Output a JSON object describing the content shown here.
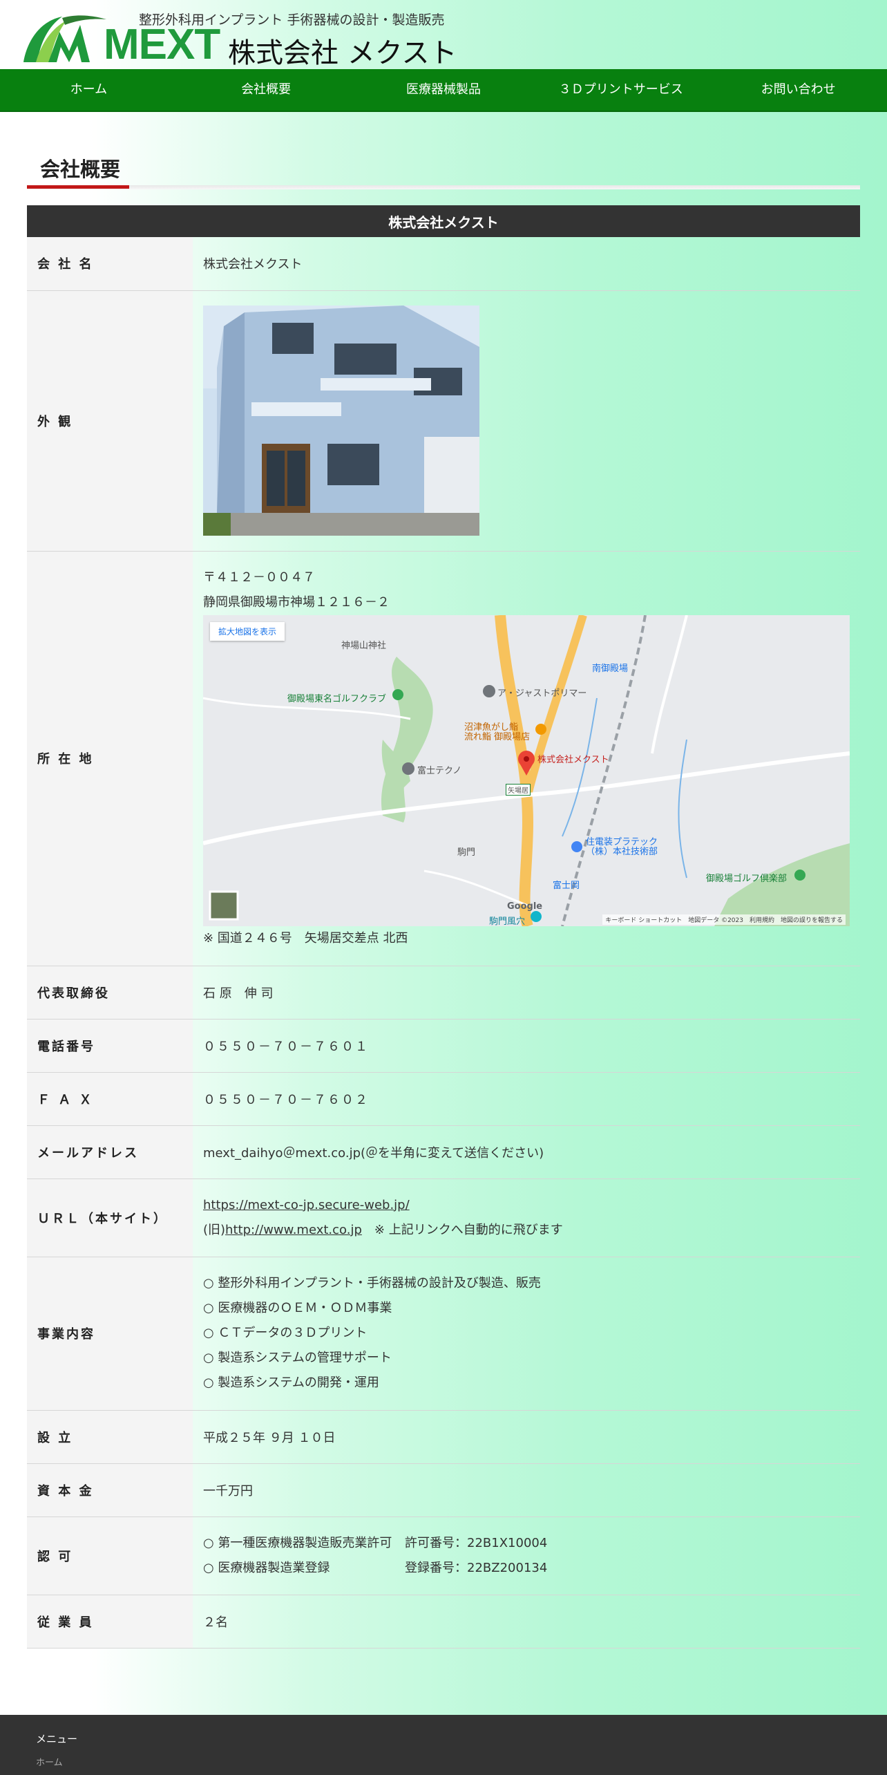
{
  "header": {
    "tagline": "整形外科用インプラント 手術器械の設計・製造販売",
    "logo_text": "MEXT",
    "company_name": "株式会社 メクスト"
  },
  "nav": {
    "items": [
      {
        "label": "ホーム"
      },
      {
        "label": "会社概要"
      },
      {
        "label": "医療器械製品"
      },
      {
        "label": "３Ｄプリントサービス"
      },
      {
        "label": "お問い合わせ"
      }
    ]
  },
  "section": {
    "title": "会社概要"
  },
  "table": {
    "caption": "株式会社メクスト",
    "company": {
      "label": "会 社 名",
      "value": "株式会社メクスト"
    },
    "exterior": {
      "label": "外 観"
    },
    "location": {
      "label": "所 在 地",
      "zip": "〒４１２－００４７",
      "address": "静岡県御殿場市神場１２１６－２",
      "note": "※ 国道２４６号　矢場居交差点 北西"
    },
    "representative": {
      "label": "代表取締役",
      "value": "石 原　伸 司"
    },
    "phone": {
      "label": "電話番号",
      "value": "０５５０－７０－７６０１"
    },
    "fax": {
      "label": "Ｆ Ａ Ｘ",
      "value": "０５５０－７０－７６０２"
    },
    "email": {
      "label": "メールアドレス",
      "value": "mext_daihyo＠mext.co.jp(＠を半角に変えて送信ください)"
    },
    "url": {
      "label": "ＵＲＬ（本サイト）",
      "main_link": "https://mext-co-jp.secure-web.jp/",
      "old_prefix": "(旧)",
      "old_link": "http://www.mext.co.jp",
      "old_note": "　※ 上記リンクへ自動的に飛びます"
    },
    "business": {
      "label": "事業内容",
      "items": [
        "○ 整形外科用インプラント・手術器械の設計及び製造、販売",
        "○ 医療機器のＯＥＭ・ＯＤＭ事業",
        "○ ＣＴデータの３Ｄプリント",
        "○ 製造系システムの管理サポート",
        "○ 製造系システムの開発・運用"
      ]
    },
    "founded": {
      "label": "設 立",
      "value": "平成２５年 ９月 １０日"
    },
    "capital": {
      "label": "資 本 金",
      "value": "一千万円"
    },
    "license": {
      "label": "認 可",
      "items": [
        {
          "name": "○ 第一種医療機器製造販売業許可",
          "number": "許可番号：22B1X10004"
        },
        {
          "name": "○ 医療機器製造業登録",
          "number": "登録番号：22BZ200134"
        }
      ]
    },
    "employees": {
      "label": "従 業 員",
      "value": "２名"
    }
  },
  "map": {
    "enlarge_button": "拡大地図を表示",
    "labels": {
      "shrine": "神場山神社",
      "golf_east": "御殿場東名ゴルフクラブ",
      "just_polymer": "ア・ジャストポリマー",
      "minami": "南御殿場",
      "sushi": "沼津魚がし鮨\n流れ鮨 御殿場店",
      "mext": "株式会社メクスト",
      "fuji_techno": "富士テクノ",
      "yabai": "矢場居",
      "sumitomo": "住電装プラテック\n（株）本社技術部",
      "komakado": "駒門",
      "fujioka": "富士岡",
      "golf_gotemba": "御殿場ゴルフ倶楽部",
      "komakado_cave": "駒門風穴",
      "google": "Google"
    },
    "attribution": "キーボード ショートカット　地図データ ©2023　利用規約　地図の誤りを報告する"
  },
  "footer": {
    "title": "メニュー",
    "link": "ホーム"
  },
  "colors": {
    "nav_green": "#08800f",
    "logo_green": "#1f9a3c",
    "accent_red": "#c21818",
    "caption_dark": "#333333"
  }
}
